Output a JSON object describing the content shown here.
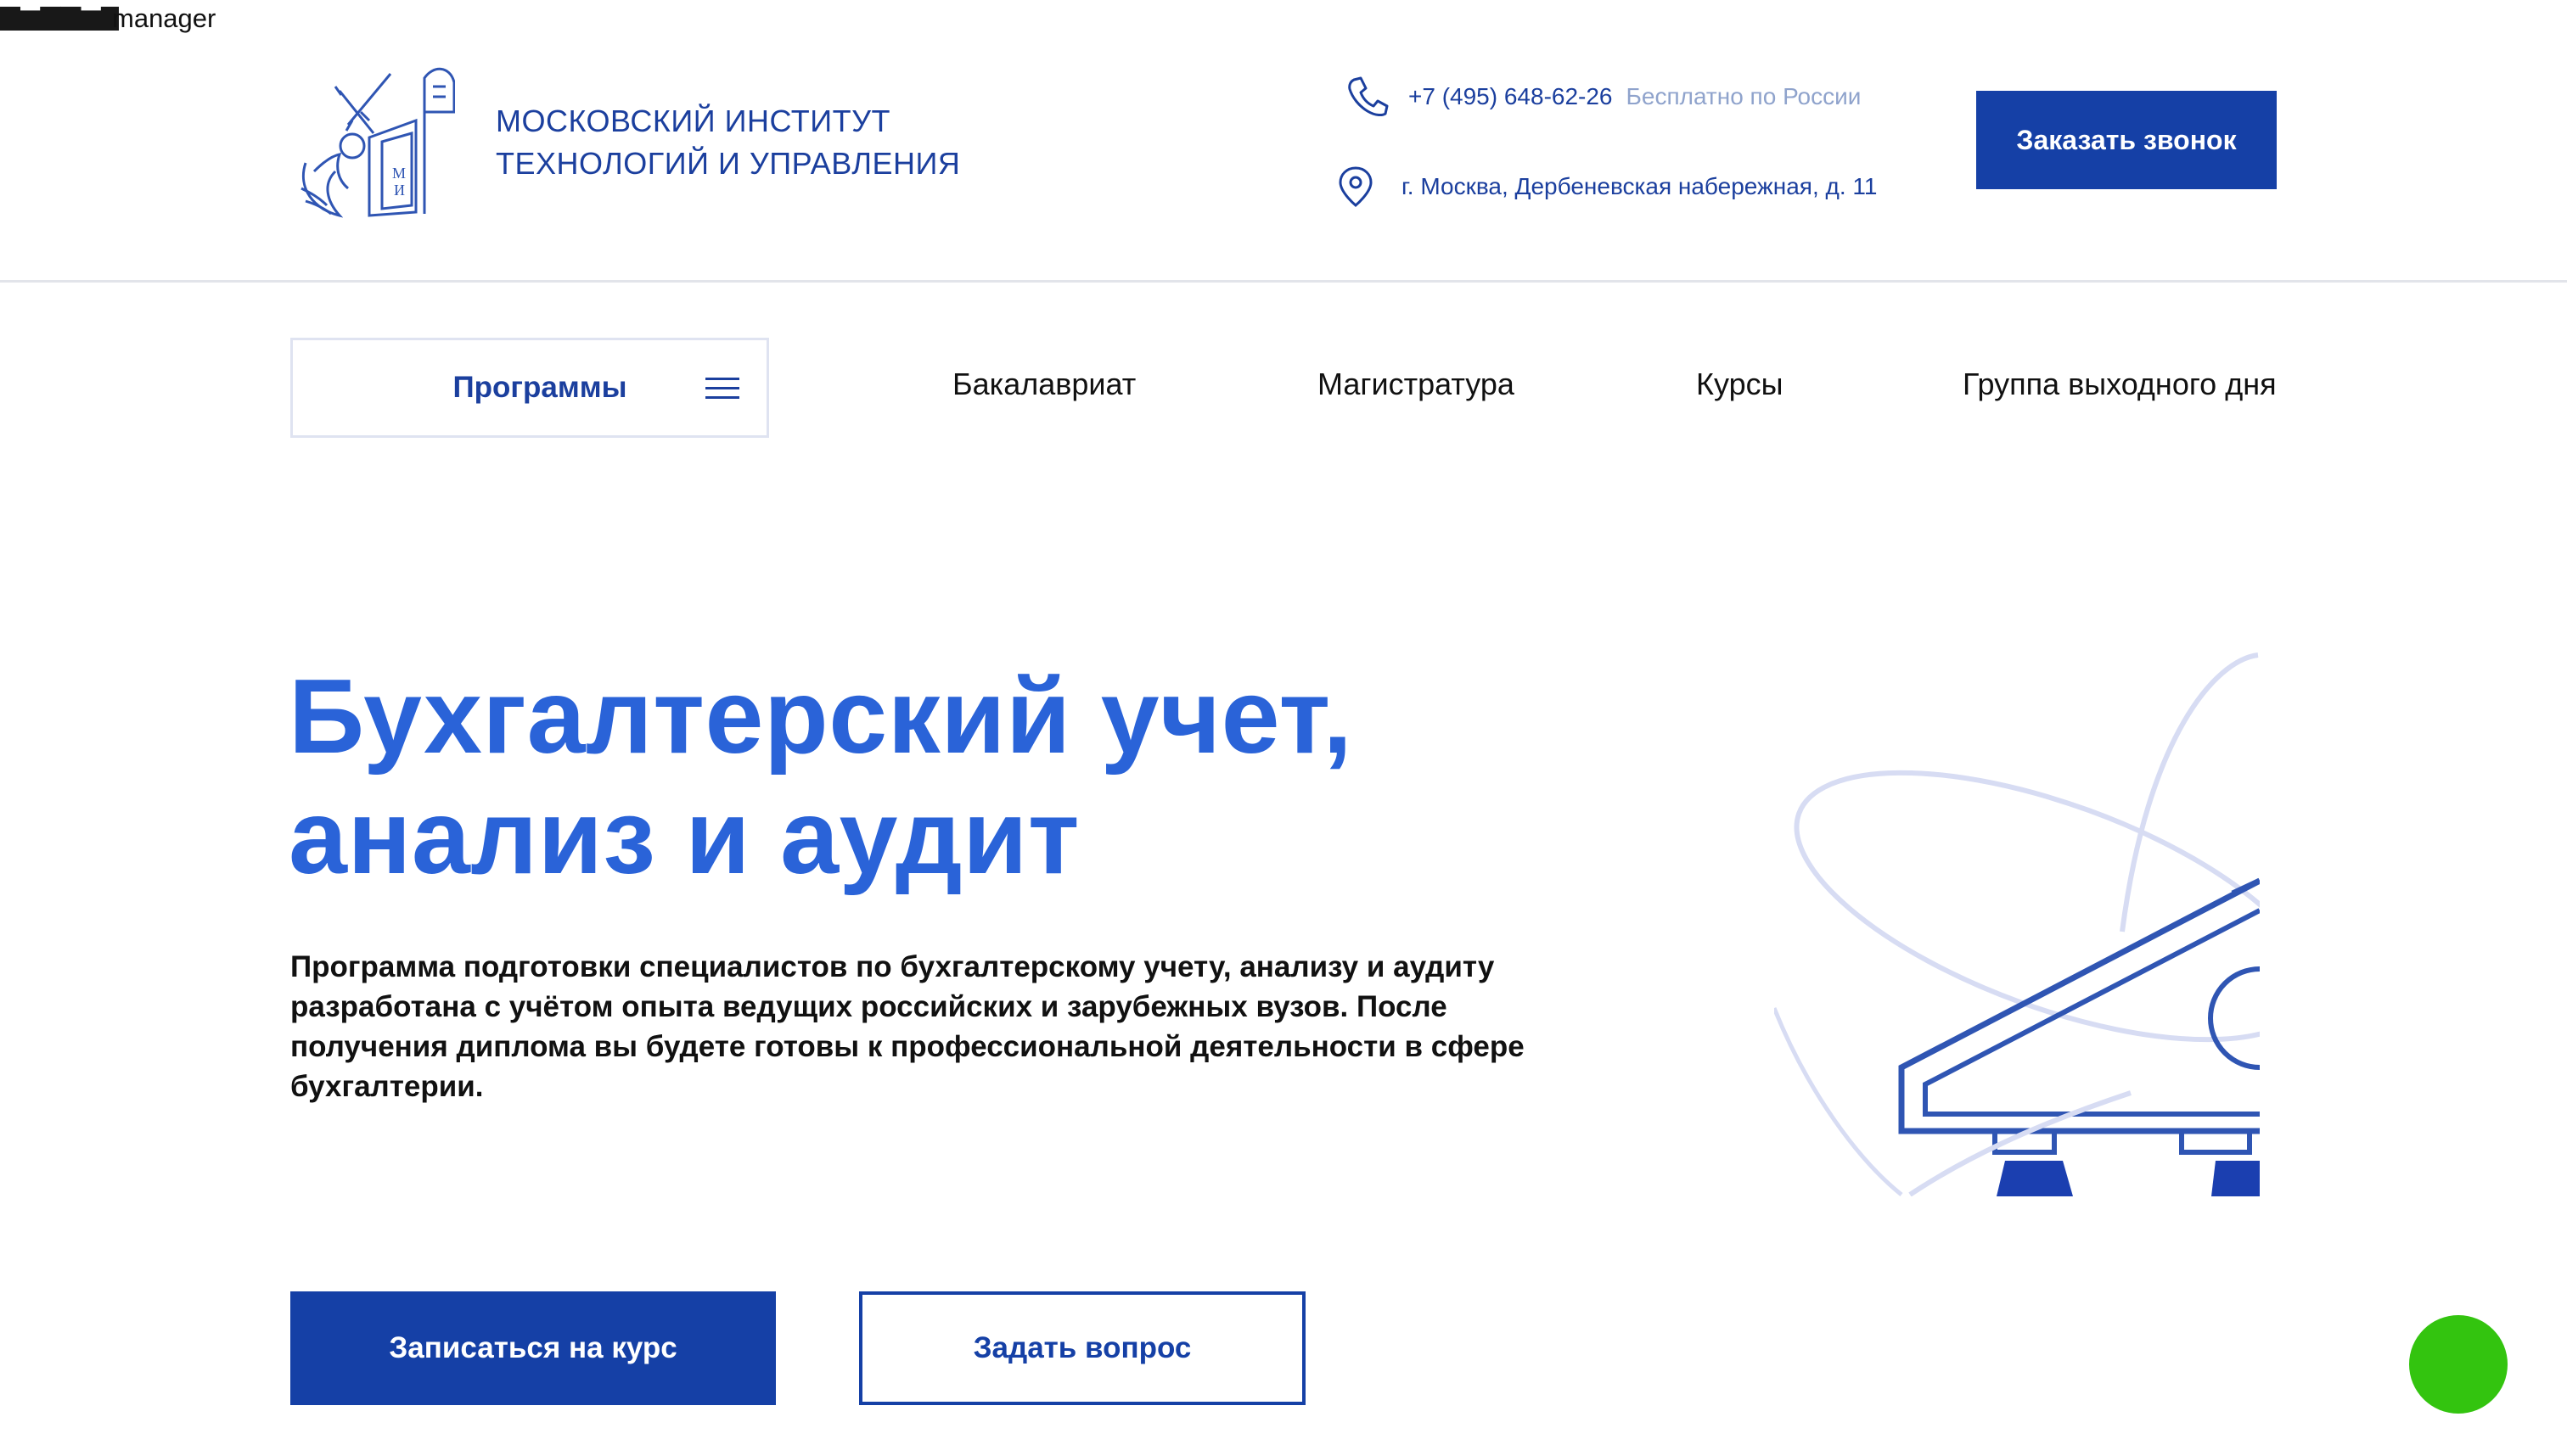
{
  "overlay": {
    "label": "manager"
  },
  "header": {
    "institute_line1": "МОСКОВСКИЙ ИНСТИТУТ",
    "institute_line2": "ТЕХНОЛОГИЙ И УПРАВЛЕНИЯ",
    "phone": "+7 (495) 648-62-26",
    "phone_note": "Бесплатно по России",
    "address": "г. Москва, Дербеневская набережная, д. 11",
    "call_button": "Заказать звонок",
    "logo_letters": [
      "М",
      "И"
    ]
  },
  "nav": {
    "programs_label": "Программы",
    "links": [
      "Бакалавриат",
      "Магистратура",
      "Курсы",
      "Группа выходного дня"
    ]
  },
  "hero": {
    "title_line1": "Бухгалтерский учет,",
    "title_line2": "анализ и аудит",
    "description": "Программа подготовки специалистов по бухгалтерскому учету, анализу и аудиту разработана с учётом опыта ведущих российских и зарубежных вузов. После получения диплома вы будете готовы к профессиональной деятельности в сфере бухгалтерии.",
    "enroll_button": "Записаться на курс",
    "ask_button": "Задать вопрос"
  },
  "colors": {
    "brand_dark": "#1540a6",
    "brand_text": "#1b3f9e",
    "hero_title": "#2a63d8",
    "muted": "#8fa3cc",
    "chat": "#33c40f"
  },
  "icons": [
    "logo-emblem-icon",
    "phone-icon",
    "location-pin-icon",
    "menu-burger-icon",
    "monument-illustration-icon",
    "chat-bubble-icon"
  ]
}
